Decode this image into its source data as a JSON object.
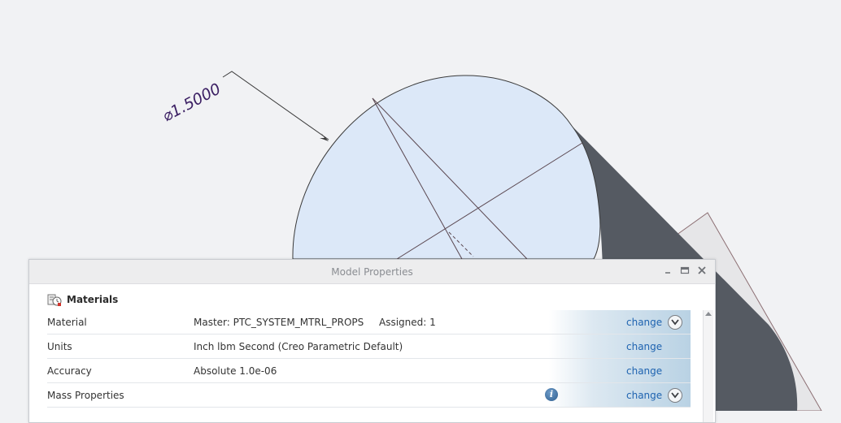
{
  "graphics": {
    "dimension_text": "⌀1.5000",
    "colors": {
      "background": "#f1f2f4",
      "face": "#dce8f8",
      "shadow": "#555a62",
      "outline": "#3a3a3a",
      "dimension": "#3b1f63"
    }
  },
  "dialog": {
    "title": "Model Properties",
    "minimize_icon": "minimize-icon",
    "maximize_icon": "maximize-icon",
    "close_icon": "close-icon",
    "section": {
      "title": "Materials",
      "icon": "materials-icon"
    },
    "rows": [
      {
        "label": "Material",
        "value": "Master: PTC_SYSTEM_MTRL_PROPS",
        "extra": "Assigned: 1",
        "action": "change",
        "expand": true
      },
      {
        "label": "Units",
        "value": "Inch lbm Second (Creo Parametric Default)",
        "action": "change"
      },
      {
        "label": "Accuracy",
        "value": "Absolute 1.0e-06",
        "action": "change"
      },
      {
        "label": "Mass Properties",
        "value": "",
        "action": "change",
        "help": true,
        "expand": true
      }
    ]
  }
}
